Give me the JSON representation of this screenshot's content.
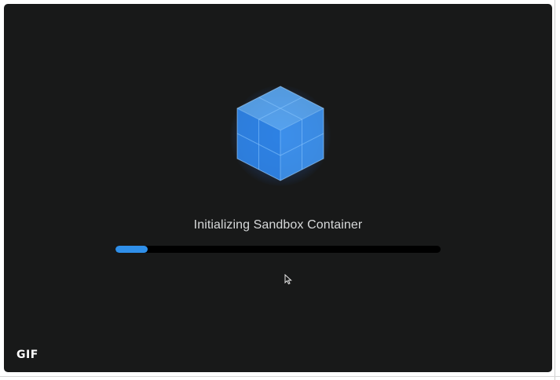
{
  "loader": {
    "status_text": "Initializing Sandbox Container",
    "progress": 0.1,
    "colors": {
      "background": "#181919",
      "progress_track": "#000000",
      "progress_fill": "#2f8fe9",
      "cube": "#3a8ef0"
    }
  },
  "cube_icon": "cube-icon",
  "cursor_icon": "pointer-cursor-icon",
  "badge": {
    "label": "GIF"
  }
}
